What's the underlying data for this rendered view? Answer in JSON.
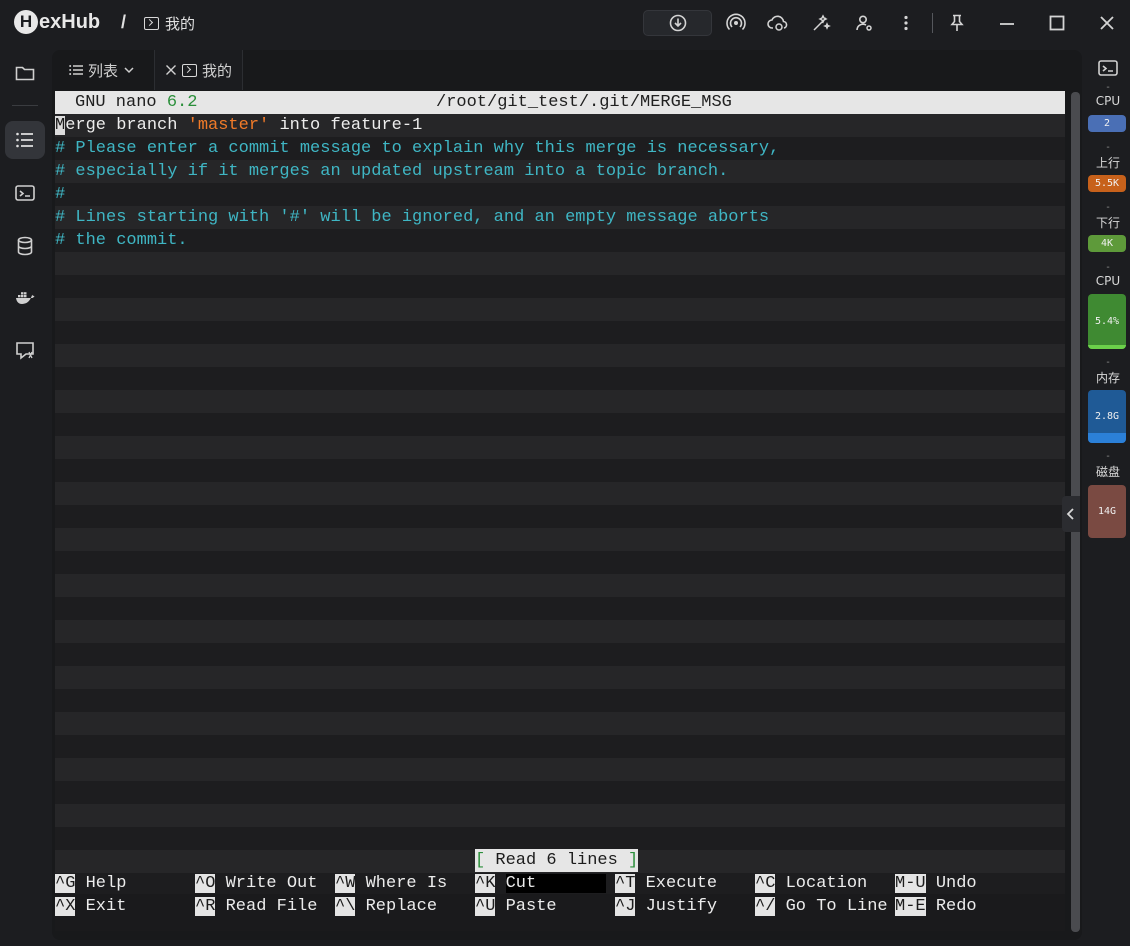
{
  "app": {
    "logo_initial": "H",
    "logo_rest": "exHub",
    "breadcrumb_sep": "/",
    "breadcrumb_label": "我的"
  },
  "toolbar": {
    "icons": [
      "download-icon",
      "broadcast-icon",
      "cloud-sync-icon",
      "magic-wand-icon",
      "user-settings-icon",
      "more-vertical-icon",
      "pin-icon",
      "minimize-icon",
      "maximize-icon",
      "close-icon"
    ]
  },
  "sidebar": {
    "items": [
      {
        "icon": "folder-icon",
        "active": false
      },
      {
        "icon": "list-icon",
        "active": true
      },
      {
        "icon": "terminal-icon",
        "active": false
      },
      {
        "icon": "database-icon",
        "active": false
      },
      {
        "icon": "docker-icon",
        "active": false
      },
      {
        "icon": "chat-icon",
        "active": false
      }
    ]
  },
  "tabs": [
    {
      "label": "列表",
      "kind": "list"
    },
    {
      "label": "我的",
      "kind": "terminal",
      "active": true
    }
  ],
  "nano": {
    "title_prefix": "GNU nano ",
    "version": "6.2",
    "file": "/root/git_test/.git/MERGE_MSG",
    "line1_cursor": "M",
    "line1_a": "erge branch ",
    "line1_quoted": "'master'",
    "line1_b": " into feature-1",
    "comments": [
      "# Please enter a commit message to explain why this merge is necessary,",
      "# especially if it merges an updated upstream into a topic branch.",
      "#",
      "# Lines starting with '#' will be ignored, and an empty message aborts",
      "# the commit."
    ],
    "status_open": "[ ",
    "status": "Read 6 lines",
    "status_close": " ]",
    "shortcuts_row1": [
      {
        "key": "^G",
        "label": "Help"
      },
      {
        "key": "^O",
        "label": "Write Out"
      },
      {
        "key": "^W",
        "label": "Where Is"
      },
      {
        "key": "^K",
        "label": "Cut"
      },
      {
        "key": "^T",
        "label": "Execute"
      },
      {
        "key": "^C",
        "label": "Location"
      },
      {
        "key": "M-U",
        "label": "Undo"
      }
    ],
    "shortcuts_row2": [
      {
        "key": "^X",
        "label": "Exit"
      },
      {
        "key": "^R",
        "label": "Read File"
      },
      {
        "key": "^\\",
        "label": "Replace"
      },
      {
        "key": "^U",
        "label": "Paste"
      },
      {
        "key": "^J",
        "label": "Justify"
      },
      {
        "key": "^/",
        "label": "Go To Line"
      },
      {
        "key": "M-E",
        "label": "Redo"
      }
    ]
  },
  "monitor": {
    "dash": "-",
    "cpu_cores_label": "CPU",
    "cpu_cores": "2",
    "up_label": "上行",
    "up_value": "5.5K",
    "down_label": "下行",
    "down_value": "4K",
    "cpu_label": "CPU",
    "cpu_value": "5.4%",
    "cpu_level": 0.054,
    "mem_label": "内存",
    "mem_value": "2.8G",
    "disk_label": "磁盘",
    "disk_value": "14G",
    "colors": {
      "cores": "#4a6fb5",
      "up": "#c7611b",
      "down": "#5e9a3a",
      "cpu": "#3f8a32",
      "mem": "#1f5a96",
      "disk": "#7a4a42"
    }
  }
}
